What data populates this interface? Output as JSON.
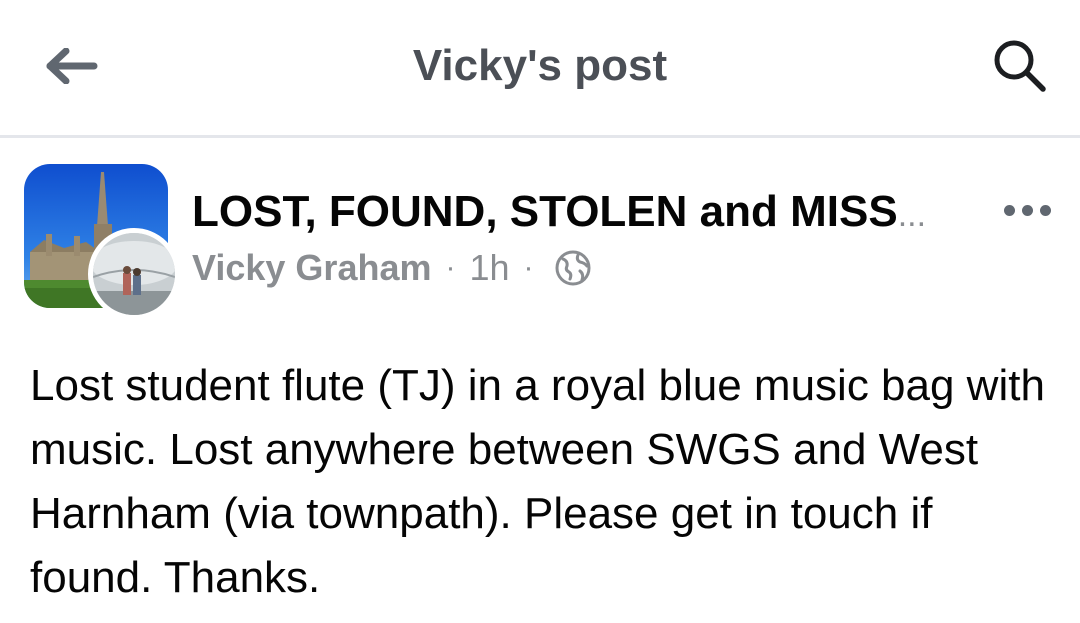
{
  "header": {
    "title": "Vicky's post",
    "back_icon": "arrow-left-icon",
    "search_icon": "search-icon"
  },
  "post": {
    "group_name": "LOST, FOUND, STOLEN and MISS",
    "group_name_ellipsis": "...",
    "author": "Vicky Graham",
    "separator": "·",
    "time": "1h",
    "privacy_icon": "globe-icon",
    "more_icon": "more-horizontal-icon",
    "body": "Lost student flute (TJ) in a royal blue music bag with music. Lost anywhere between SWGS and West Harnham (via townpath). Please get in touch if found. Thanks."
  },
  "colors": {
    "title_gray": "#4b4f56",
    "meta_gray": "#8a8d91",
    "text": "#050505",
    "divider": "#e4e6eb"
  }
}
